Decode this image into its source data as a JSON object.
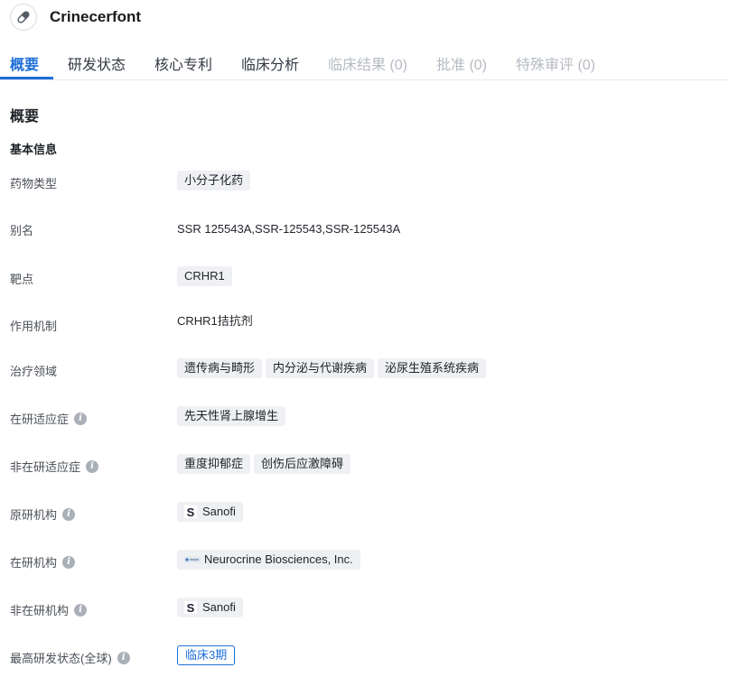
{
  "header": {
    "title": "Crinecerfont",
    "icon": "pill-icon"
  },
  "tabs": [
    {
      "label": "概要",
      "state": "active"
    },
    {
      "label": "研发状态",
      "state": "normal"
    },
    {
      "label": "核心专利",
      "state": "normal"
    },
    {
      "label": "临床分析",
      "state": "normal"
    },
    {
      "label": "临床结果 (0)",
      "state": "disabled"
    },
    {
      "label": "批准 (0)",
      "state": "disabled"
    },
    {
      "label": "特殊审评 (0)",
      "state": "disabled"
    }
  ],
  "overview": {
    "title": "概要",
    "basic_info_title": "基本信息",
    "fields": {
      "drug_type": {
        "label": "药物类型",
        "tags": [
          "小分子化药"
        ]
      },
      "aliases": {
        "label": "别名",
        "value": "SSR 125543A,SSR-125543,SSR-125543A"
      },
      "target": {
        "label": "靶点",
        "tags": [
          "CRHR1"
        ]
      },
      "mechanism": {
        "label": "作用机制",
        "value": "CRHR1拮抗剂"
      },
      "therapeutic_areas": {
        "label": "治疗领域",
        "tags": [
          "遗传病与畸形",
          "内分泌与代谢疾病",
          "泌尿生殖系统疾病"
        ]
      },
      "active_indications": {
        "label": "在研适应症",
        "tags": [
          "先天性肾上腺增生"
        ]
      },
      "inactive_indications": {
        "label": "非在研适应症",
        "tags": [
          "重度抑郁症",
          "创伤后应激障碍"
        ]
      },
      "originator": {
        "label": "原研机构",
        "org": "Sanofi"
      },
      "active_org": {
        "label": "在研机构",
        "org": "Neurocrine Biosciences, Inc."
      },
      "inactive_org": {
        "label": "非在研机构",
        "org": "Sanofi"
      },
      "highest_phase": {
        "label": "最高研发状态(全球)",
        "value": "临床3期"
      }
    }
  },
  "colors": {
    "accent": "#1e6fd9",
    "tag_bg": "#eef0f3",
    "disabled": "#b6bbc3"
  }
}
